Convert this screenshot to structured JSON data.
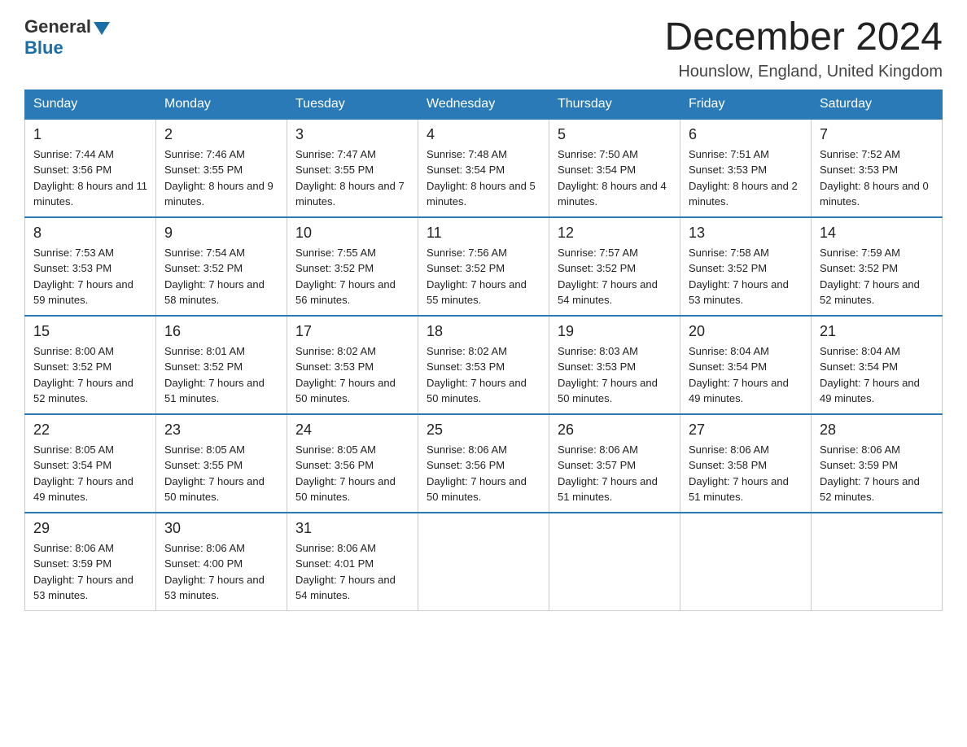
{
  "header": {
    "title": "December 2024",
    "location": "Hounslow, England, United Kingdom",
    "logo_general": "General",
    "logo_blue": "Blue"
  },
  "days_of_week": [
    "Sunday",
    "Monday",
    "Tuesday",
    "Wednesday",
    "Thursday",
    "Friday",
    "Saturday"
  ],
  "weeks": [
    [
      {
        "day": "1",
        "sunrise": "7:44 AM",
        "sunset": "3:56 PM",
        "daylight": "8 hours and 11 minutes."
      },
      {
        "day": "2",
        "sunrise": "7:46 AM",
        "sunset": "3:55 PM",
        "daylight": "8 hours and 9 minutes."
      },
      {
        "day": "3",
        "sunrise": "7:47 AM",
        "sunset": "3:55 PM",
        "daylight": "8 hours and 7 minutes."
      },
      {
        "day": "4",
        "sunrise": "7:48 AM",
        "sunset": "3:54 PM",
        "daylight": "8 hours and 5 minutes."
      },
      {
        "day": "5",
        "sunrise": "7:50 AM",
        "sunset": "3:54 PM",
        "daylight": "8 hours and 4 minutes."
      },
      {
        "day": "6",
        "sunrise": "7:51 AM",
        "sunset": "3:53 PM",
        "daylight": "8 hours and 2 minutes."
      },
      {
        "day": "7",
        "sunrise": "7:52 AM",
        "sunset": "3:53 PM",
        "daylight": "8 hours and 0 minutes."
      }
    ],
    [
      {
        "day": "8",
        "sunrise": "7:53 AM",
        "sunset": "3:53 PM",
        "daylight": "7 hours and 59 minutes."
      },
      {
        "day": "9",
        "sunrise": "7:54 AM",
        "sunset": "3:52 PM",
        "daylight": "7 hours and 58 minutes."
      },
      {
        "day": "10",
        "sunrise": "7:55 AM",
        "sunset": "3:52 PM",
        "daylight": "7 hours and 56 minutes."
      },
      {
        "day": "11",
        "sunrise": "7:56 AM",
        "sunset": "3:52 PM",
        "daylight": "7 hours and 55 minutes."
      },
      {
        "day": "12",
        "sunrise": "7:57 AM",
        "sunset": "3:52 PM",
        "daylight": "7 hours and 54 minutes."
      },
      {
        "day": "13",
        "sunrise": "7:58 AM",
        "sunset": "3:52 PM",
        "daylight": "7 hours and 53 minutes."
      },
      {
        "day": "14",
        "sunrise": "7:59 AM",
        "sunset": "3:52 PM",
        "daylight": "7 hours and 52 minutes."
      }
    ],
    [
      {
        "day": "15",
        "sunrise": "8:00 AM",
        "sunset": "3:52 PM",
        "daylight": "7 hours and 52 minutes."
      },
      {
        "day": "16",
        "sunrise": "8:01 AM",
        "sunset": "3:52 PM",
        "daylight": "7 hours and 51 minutes."
      },
      {
        "day": "17",
        "sunrise": "8:02 AM",
        "sunset": "3:53 PM",
        "daylight": "7 hours and 50 minutes."
      },
      {
        "day": "18",
        "sunrise": "8:02 AM",
        "sunset": "3:53 PM",
        "daylight": "7 hours and 50 minutes."
      },
      {
        "day": "19",
        "sunrise": "8:03 AM",
        "sunset": "3:53 PM",
        "daylight": "7 hours and 50 minutes."
      },
      {
        "day": "20",
        "sunrise": "8:04 AM",
        "sunset": "3:54 PM",
        "daylight": "7 hours and 49 minutes."
      },
      {
        "day": "21",
        "sunrise": "8:04 AM",
        "sunset": "3:54 PM",
        "daylight": "7 hours and 49 minutes."
      }
    ],
    [
      {
        "day": "22",
        "sunrise": "8:05 AM",
        "sunset": "3:54 PM",
        "daylight": "7 hours and 49 minutes."
      },
      {
        "day": "23",
        "sunrise": "8:05 AM",
        "sunset": "3:55 PM",
        "daylight": "7 hours and 50 minutes."
      },
      {
        "day": "24",
        "sunrise": "8:05 AM",
        "sunset": "3:56 PM",
        "daylight": "7 hours and 50 minutes."
      },
      {
        "day": "25",
        "sunrise": "8:06 AM",
        "sunset": "3:56 PM",
        "daylight": "7 hours and 50 minutes."
      },
      {
        "day": "26",
        "sunrise": "8:06 AM",
        "sunset": "3:57 PM",
        "daylight": "7 hours and 51 minutes."
      },
      {
        "day": "27",
        "sunrise": "8:06 AM",
        "sunset": "3:58 PM",
        "daylight": "7 hours and 51 minutes."
      },
      {
        "day": "28",
        "sunrise": "8:06 AM",
        "sunset": "3:59 PM",
        "daylight": "7 hours and 52 minutes."
      }
    ],
    [
      {
        "day": "29",
        "sunrise": "8:06 AM",
        "sunset": "3:59 PM",
        "daylight": "7 hours and 53 minutes."
      },
      {
        "day": "30",
        "sunrise": "8:06 AM",
        "sunset": "4:00 PM",
        "daylight": "7 hours and 53 minutes."
      },
      {
        "day": "31",
        "sunrise": "8:06 AM",
        "sunset": "4:01 PM",
        "daylight": "7 hours and 54 minutes."
      },
      null,
      null,
      null,
      null
    ]
  ]
}
